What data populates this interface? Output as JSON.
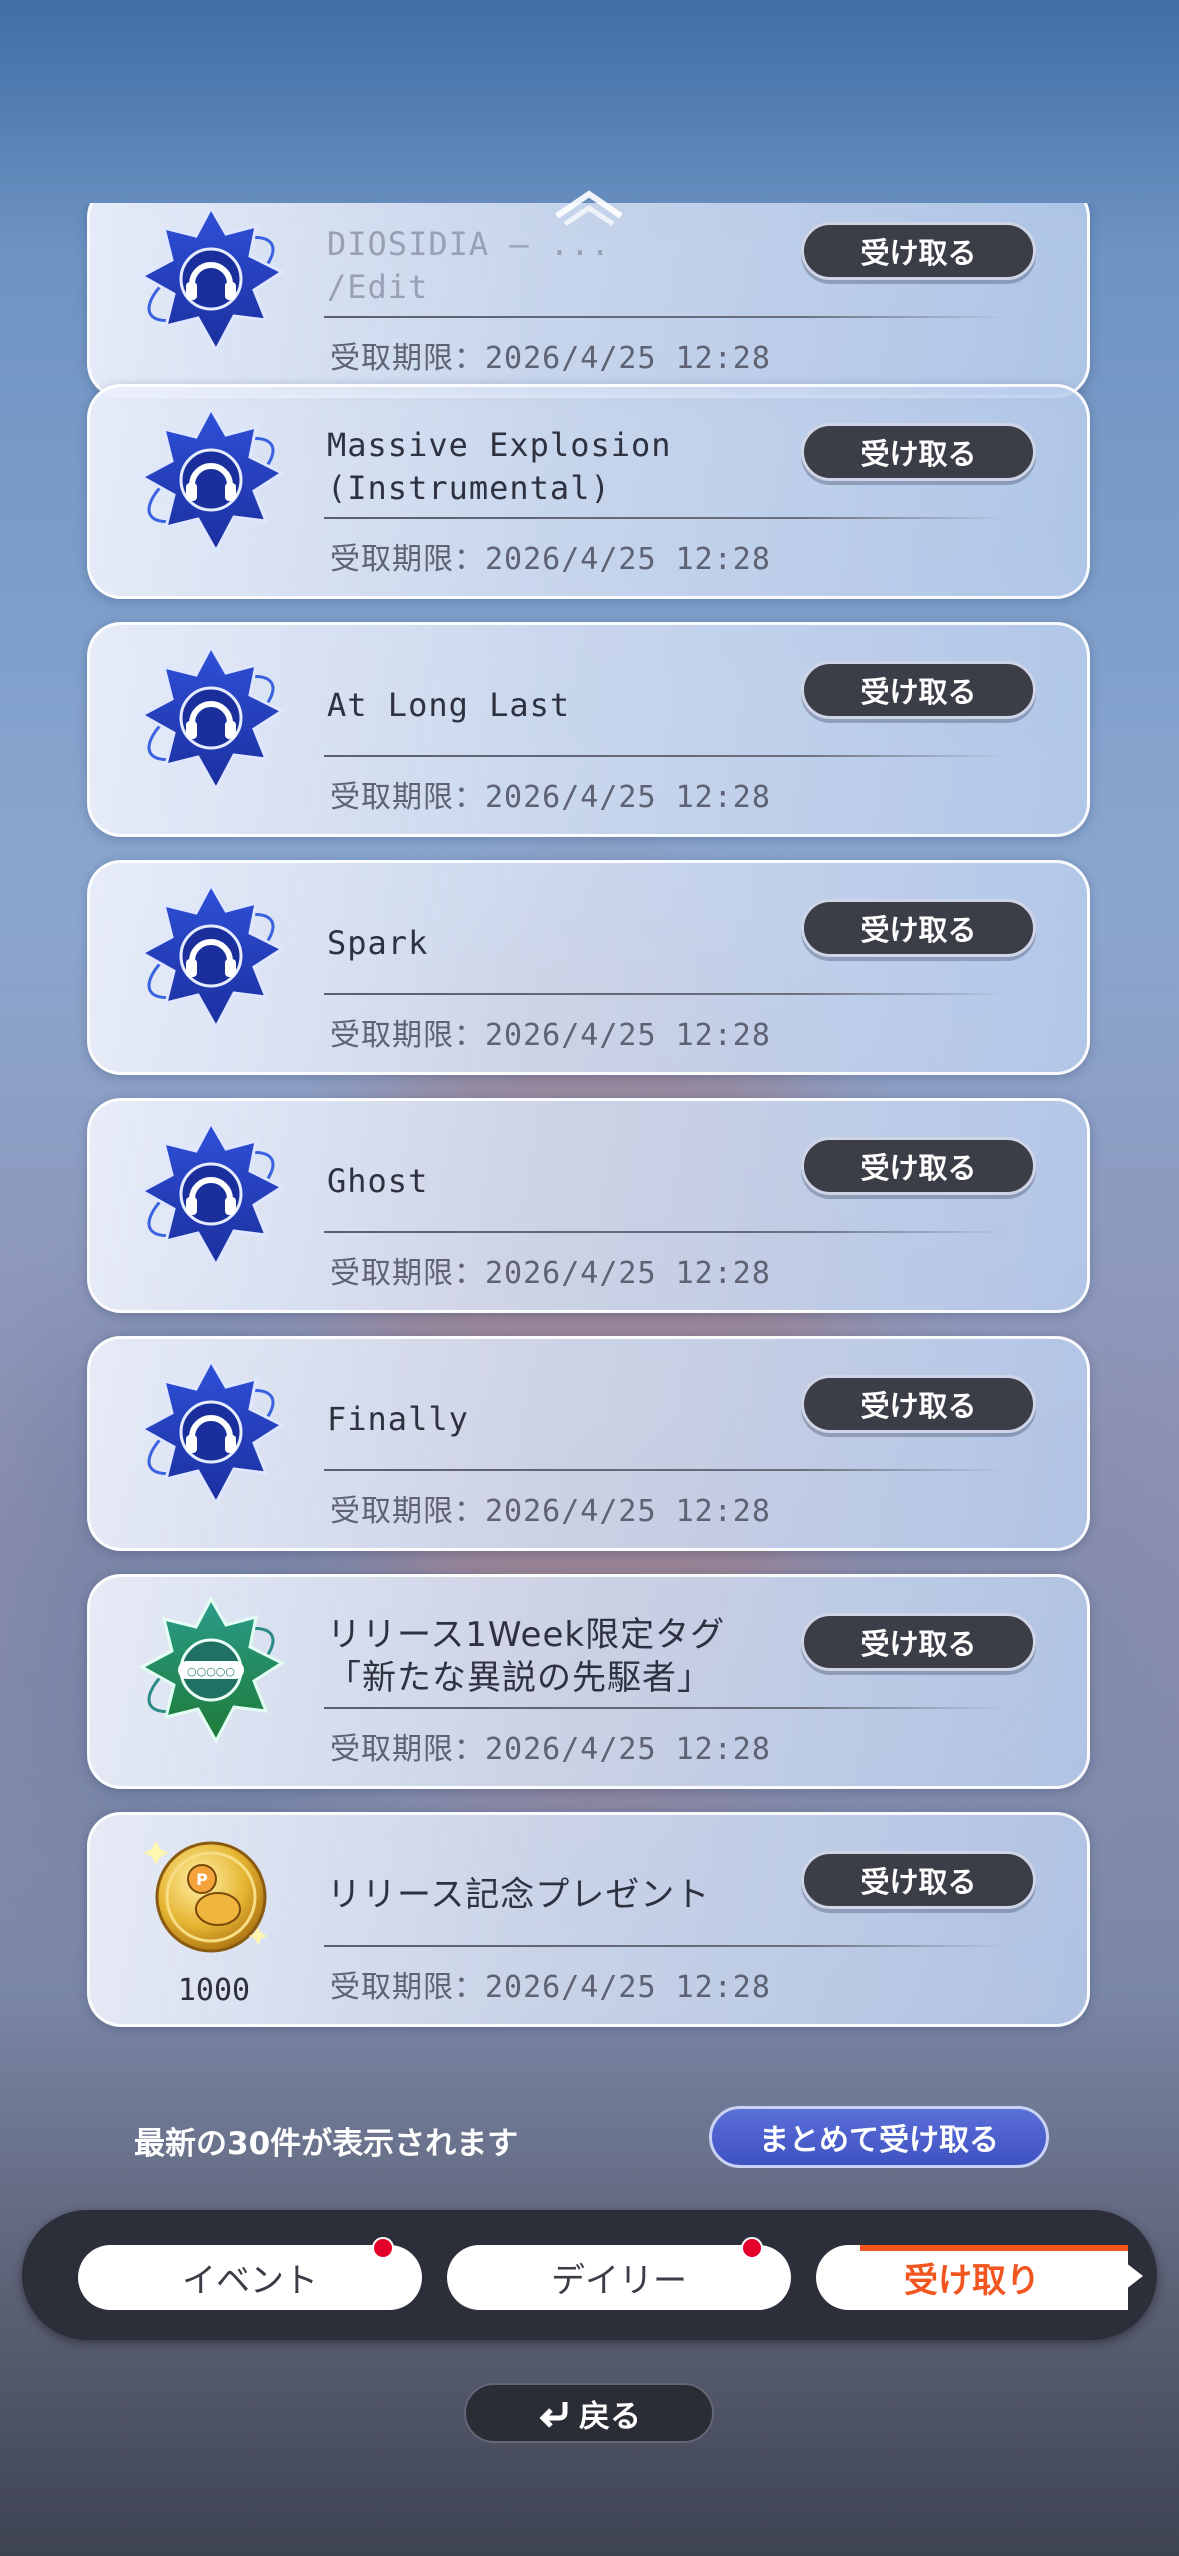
{
  "colors": {
    "accent_orange": "#f2551e",
    "button_dark": "#3b3d47",
    "bulk_blue": "#4b5fd0",
    "notify_red": "#e4002b"
  },
  "list": {
    "claim_label": "受け取る",
    "items": [
      {
        "icon": "music-medal-icon",
        "title": "DIOSIDIA ‒ ... \n/Edit",
        "deadline": "受取期限：2026/4/25 12:28"
      },
      {
        "icon": "music-medal-icon",
        "title": "Massive Explosion\n(Instrumental)",
        "deadline": "受取期限：2026/4/25 12:28"
      },
      {
        "icon": "music-medal-icon",
        "title": "At Long Last",
        "deadline": "受取期限：2026/4/25 12:28"
      },
      {
        "icon": "music-medal-icon",
        "title": "Spark",
        "deadline": "受取期限：2026/4/25 12:28"
      },
      {
        "icon": "music-medal-icon",
        "title": "Ghost",
        "deadline": "受取期限：2026/4/25 12:28"
      },
      {
        "icon": "music-medal-icon",
        "title": "Finally",
        "deadline": "受取期限：2026/4/25 12:28"
      },
      {
        "icon": "tag-medal-icon",
        "title": "リリース1Week限定タグ\n「新たな異説の先駆者」",
        "deadline": "受取期限：2026/4/25 12:28"
      },
      {
        "icon": "gold-coin-icon",
        "title": "リリース記念プレゼント",
        "deadline": "受取期限：2026/4/25 12:28",
        "count": "1000"
      }
    ]
  },
  "footer": {
    "note": "最新の30件が表示されます",
    "bulk_claim": "まとめて受け取る"
  },
  "tabs": [
    {
      "label": "イベント",
      "notify": true
    },
    {
      "label": "デイリー",
      "notify": true
    },
    {
      "label": "受け取り",
      "active": true
    }
  ],
  "back": {
    "label": "戻る"
  }
}
